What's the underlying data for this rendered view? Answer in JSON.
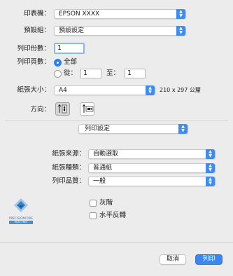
{
  "printer": {
    "label": "印表機：",
    "value": "EPSON XXXX"
  },
  "preset": {
    "label": "預設組：",
    "value": "預設設定"
  },
  "copies": {
    "label": "列印份數：",
    "value": "1"
  },
  "pages": {
    "label": "列印頁數：",
    "all_label": "全部",
    "from_label": "從：",
    "from_value": "1",
    "to_label": "至：",
    "to_value": "1",
    "selected": "all"
  },
  "paper_size": {
    "label": "紙張大小：",
    "value": "A4",
    "dimensions": "210 x 297 公釐"
  },
  "orientation": {
    "label": "方向：",
    "selected": "portrait"
  },
  "section_popup": {
    "value": "列印設定"
  },
  "paper_source": {
    "label": "紙張來源：",
    "value": "自動選取"
  },
  "media_type": {
    "label": "紙張種類：",
    "value": "普通紙"
  },
  "print_quality": {
    "label": "列印品質：",
    "value": "一般"
  },
  "options": {
    "grayscale_label": "灰階",
    "grayscale_checked": false,
    "mirror_label": "水平反轉",
    "mirror_checked": false
  },
  "logo": {
    "line1": "PRECISIONCORE",
    "line2": "HEAT-FREE"
  },
  "buttons": {
    "cancel": "取消",
    "print": "列印"
  },
  "colors": {
    "accent": "#3d8cf3",
    "logo_blue": "#4a90c8"
  }
}
